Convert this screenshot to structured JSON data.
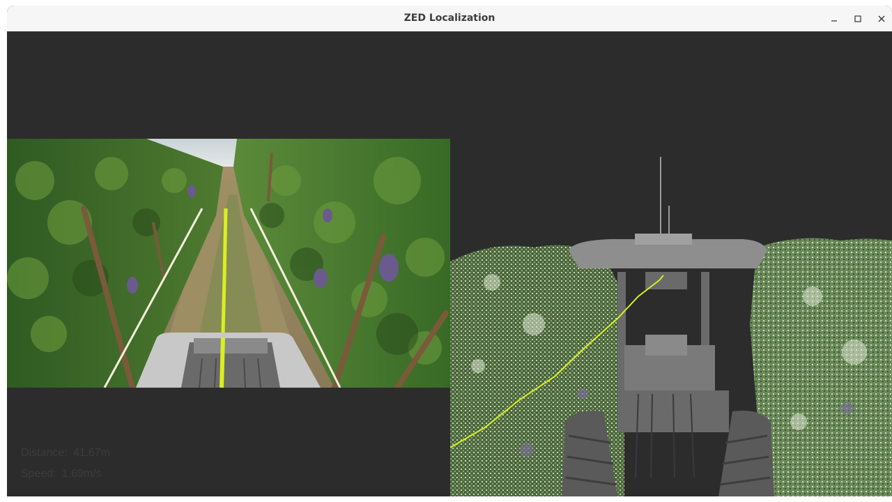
{
  "window": {
    "title": "ZED Localization",
    "controls": [
      "minimize",
      "maximize",
      "close"
    ]
  },
  "stats": {
    "distance_label": "Distance:",
    "distance_value": "41.67m",
    "speed_label": "Speed:",
    "speed_value": "1.69m/s"
  },
  "colors": {
    "background": "#2c2c2c",
    "trajectory": "#d8f020",
    "guide_lines": "#f5f0dc",
    "titlebar": "#f6f6f6"
  }
}
